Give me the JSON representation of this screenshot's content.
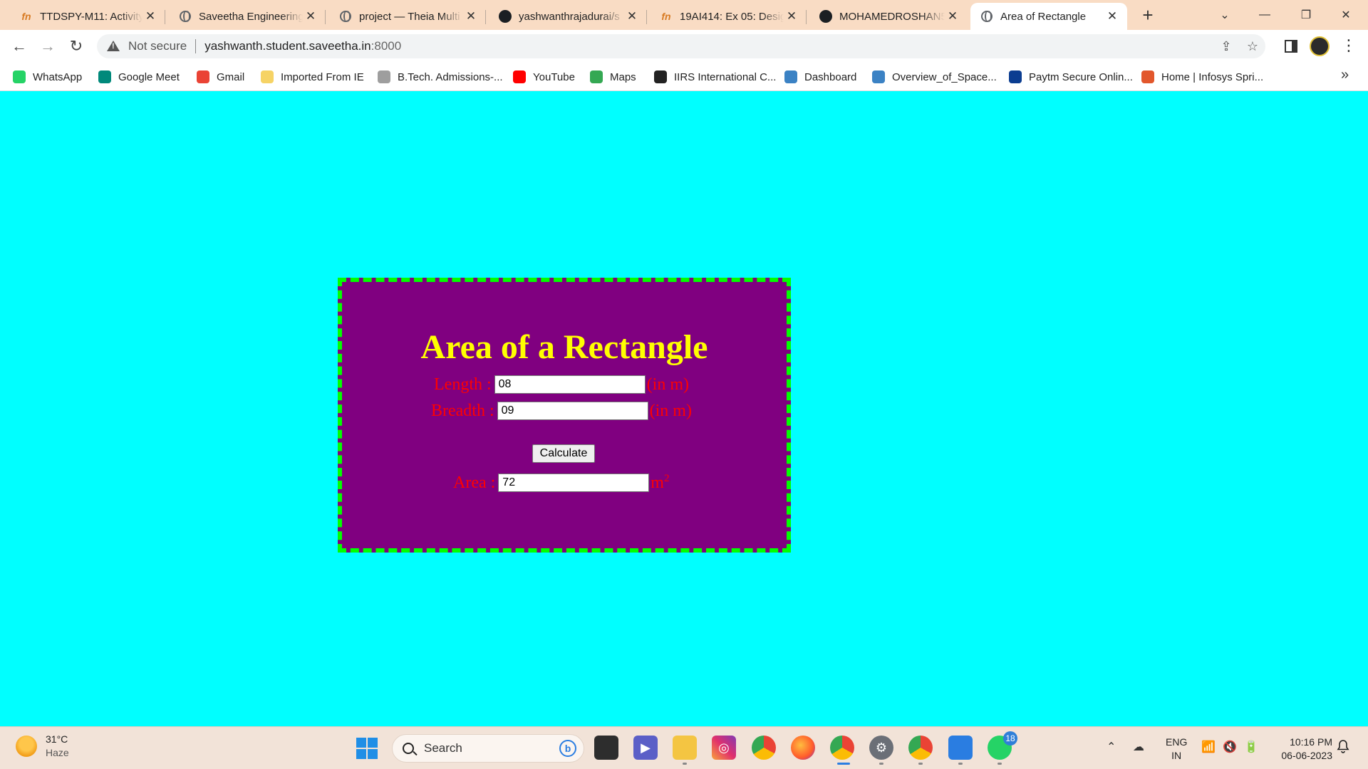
{
  "browser": {
    "tabs": [
      {
        "title": "TTDSPY-M11: Activity",
        "icon": "fn-icon"
      },
      {
        "title": "Saveetha Engineering",
        "icon": "globe-icon"
      },
      {
        "title": "project — Theia Multi",
        "icon": "globe-icon"
      },
      {
        "title": "yashwanthrajadurai/s",
        "icon": "github-icon"
      },
      {
        "title": "19AI414: Ex 05: Desig",
        "icon": "fn-icon"
      },
      {
        "title": "MOHAMEDROSHAN5",
        "icon": "github-icon"
      },
      {
        "title": "Area of Rectangle",
        "icon": "globe-icon",
        "active": true
      }
    ],
    "new_tab": "+",
    "address": {
      "security": "Not secure",
      "url_host": "yashwanth.student.saveetha.in",
      "url_port": ":8000"
    },
    "bookmarks": [
      {
        "label": "WhatsApp",
        "color": "#25d366"
      },
      {
        "label": "Google Meet",
        "color": "#00897b"
      },
      {
        "label": "Gmail",
        "color": "#ea4335"
      },
      {
        "label": "Imported From IE",
        "color": "#f6d365"
      },
      {
        "label": "B.Tech. Admissions-...",
        "color": "#9e9e9e"
      },
      {
        "label": "YouTube",
        "color": "#ff0000"
      },
      {
        "label": "Maps",
        "color": "#34a853"
      },
      {
        "label": "IIRS International C...",
        "color": "#222222"
      },
      {
        "label": "Dashboard",
        "color": "#3b82c4"
      },
      {
        "label": "Overview_of_Space...",
        "color": "#3b82c4"
      },
      {
        "label": "Paytm Secure Onlin...",
        "color": "#0b3d91"
      },
      {
        "label": "Home | Infosys Spri...",
        "color": "#e2572c"
      }
    ],
    "bookmarks_more": "»"
  },
  "page": {
    "heading": "Area of a Rectangle",
    "length_label": "Length :",
    "length_value": "08",
    "length_unit": "(in m)",
    "breadth_label": "Breadth :",
    "breadth_value": "09",
    "breadth_unit": "(in m)",
    "calc_button": "Calculate",
    "area_label": "Area :",
    "area_value": "72",
    "area_unit": "m",
    "area_unit_sup": "2",
    "colors": {
      "background": "#00ffff",
      "card": "#800080",
      "border": "#00ff00",
      "heading": "#ffff00",
      "labels": "#ff0000"
    }
  },
  "taskbar": {
    "weather_temp": "31°C",
    "weather_desc": "Haze",
    "search_placeholder": "Search",
    "whatsapp_badge": "18",
    "lang_line1": "ENG",
    "lang_line2": "IN",
    "time": "10:16 PM",
    "date": "06-06-2023"
  }
}
